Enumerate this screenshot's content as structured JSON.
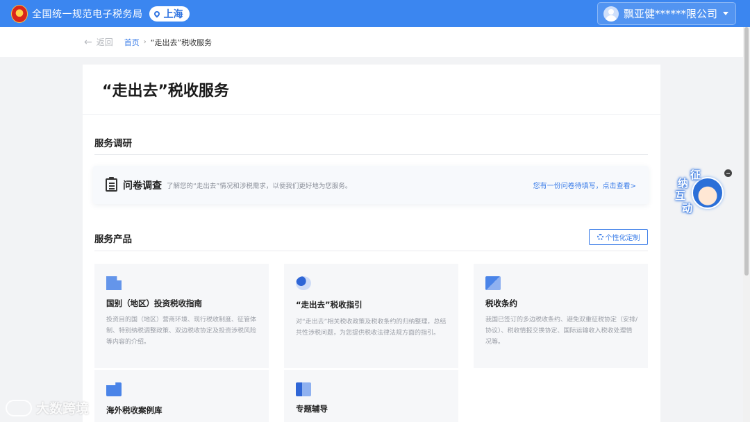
{
  "header": {
    "site_title": "全国统一规范电子税务局",
    "region": "上海",
    "user_name": "飘亚健******限公司",
    "brand_color": "#3b86f0"
  },
  "breadcrumb": {
    "back_label": "返回",
    "home": "首页",
    "separator": "›",
    "current": "“走出去”税收服务"
  },
  "page": {
    "title": "“走出去”税收服务"
  },
  "research": {
    "section_title": "服务调研",
    "survey_title": "问卷调查",
    "survey_desc": "了解您的“走出去”情况和涉税需求，以便我们更好地为您服务。",
    "survey_link": "您有一份问卷待填写，点击查看>"
  },
  "products": {
    "section_title": "服务产品",
    "custom_button": "个性化定制",
    "cards": [
      {
        "title": "国别（地区）投资税收指南",
        "desc": "投资目的国（地区）营商环境、现行税收制度、征管体制、特别纳税调整政策、双边税收协定及投资涉税风险等内容的介绍。"
      },
      {
        "title": "“走出去”税收指引",
        "desc": "对“走出去”相关税收政策及税收条约的归纳整理，总结共性涉税问题，为您提供税收法律法规方面的指引。"
      },
      {
        "title": "税收条约",
        "desc": "我国已签订的多边税收条约、避免双重征税协定（安排/协议）、税收情报交换协定、国际运输收入税收处理情况等。"
      },
      {
        "title": "海外税收案例库",
        "desc": ""
      },
      {
        "title": "专题辅导",
        "desc": ""
      }
    ]
  },
  "helper": {
    "chars": [
      "征",
      "纳",
      "互",
      "动"
    ]
  },
  "watermark": {
    "text": "大数跨境"
  }
}
